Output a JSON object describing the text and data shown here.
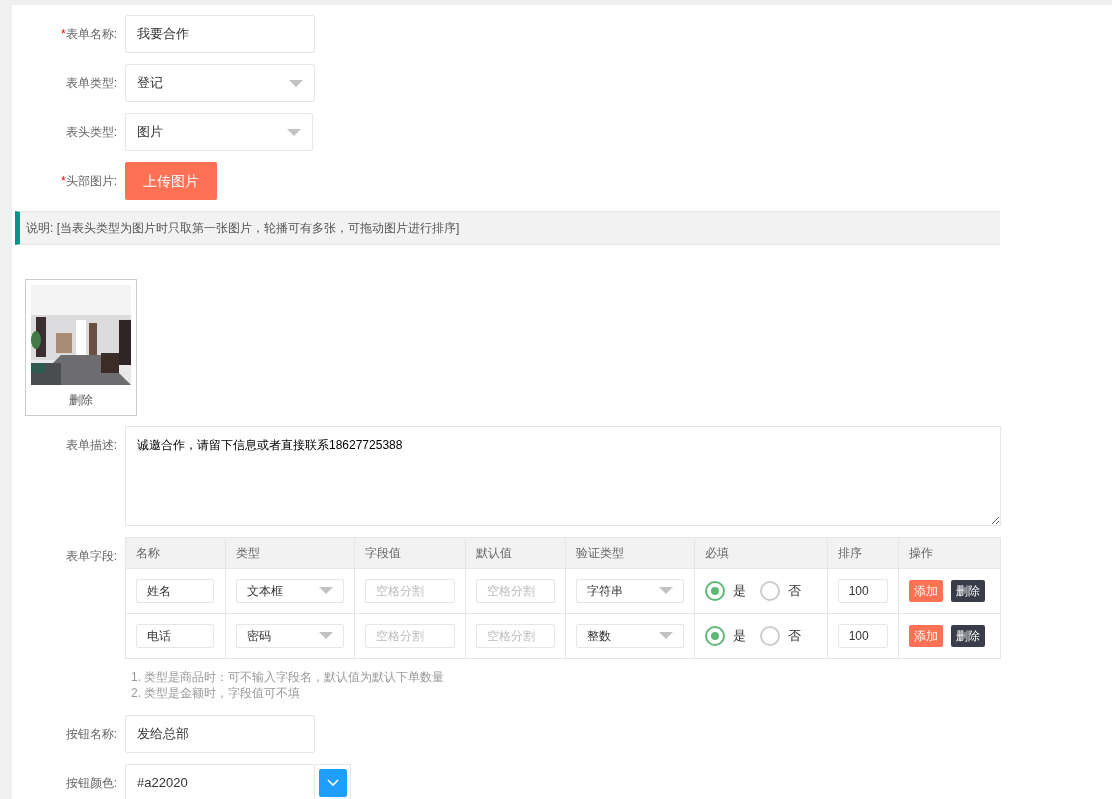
{
  "form_name": {
    "label": "表单名称:",
    "required_mark": "*",
    "value": "我要合作"
  },
  "form_type": {
    "label": "表单类型:",
    "value": "登记"
  },
  "header_type": {
    "label": "表头类型:",
    "value": "图片"
  },
  "header_image": {
    "label": "头部图片:",
    "required_mark": "*",
    "upload_button": "上传图片"
  },
  "note": "说明: [当表头类型为图片时只取第一张图片，轮播可有多张，可拖动图片进行排序]",
  "images": [
    {
      "kind": "picture",
      "delete_label": "删除"
    }
  ],
  "description": {
    "label": "表单描述:",
    "value": "诚邀合作，请留下信息或者直接联系18627725388"
  },
  "fields": {
    "label": "表单字段:",
    "columns": [
      "名称",
      "类型",
      "字段值",
      "默认值",
      "验证类型",
      "必填",
      "排序",
      "操作"
    ],
    "rows": [
      {
        "name": "姓名",
        "type": "文本框",
        "field_placeholder": "空格分割",
        "default_placeholder": "空格分割",
        "validation": "字符串",
        "required": [
          {
            "label": "是",
            "selected": true
          },
          {
            "label": "否",
            "selected": false
          }
        ],
        "sort": "100",
        "add": "添加",
        "delete": "删除"
      },
      {
        "name": "电话",
        "type": "密码",
        "field_placeholder": "空格分割",
        "default_placeholder": "空格分割",
        "validation": "整数",
        "required": [
          {
            "label": "是",
            "selected": true
          },
          {
            "label": "否",
            "selected": false
          }
        ],
        "sort": "100",
        "add": "添加",
        "delete": "删除"
      }
    ],
    "hints": [
      "1. 类型是商品时：可不输入字段名，默认值为默认下单数量",
      "2. 类型是金额时，字段值可不填"
    ]
  },
  "button_name": {
    "label": "按钮名称:",
    "value": "发给总部"
  },
  "button_color": {
    "label": "按钮颜色:",
    "value": "#a22020"
  }
}
